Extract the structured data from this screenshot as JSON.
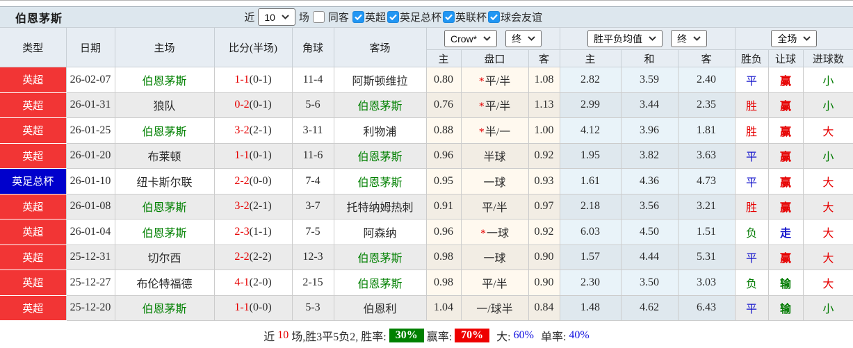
{
  "title": "伯恩茅斯",
  "controls": {
    "near_label": "近",
    "match_count": "10",
    "matches_label": "场",
    "same_opponent_label": "同客",
    "same_opponent_checked": false,
    "competitions": [
      {
        "label": "英超",
        "checked": true
      },
      {
        "label": "英足总杯",
        "checked": true
      },
      {
        "label": "英联杯",
        "checked": true
      },
      {
        "label": "球会友谊",
        "checked": true
      }
    ]
  },
  "selectors": {
    "odds_company": "Crow*",
    "odds_stage": "终",
    "mean_type": "胜平负均值",
    "mean_stage": "终",
    "scope": "全场"
  },
  "columns": {
    "type": "类型",
    "date": "日期",
    "home": "主场",
    "score": "比分(半场)",
    "corners": "角球",
    "away": "客场",
    "odds_home": "主",
    "handicap": "盘口",
    "odds_away": "客",
    "mean_home": "主",
    "mean_draw": "和",
    "mean_away": "客",
    "result": "胜负",
    "handicap_result": "让球",
    "goals": "进球数"
  },
  "rows": [
    {
      "type": "英超",
      "badge": "league",
      "date": "26-02-07",
      "home": "伯恩茅斯",
      "home_self": true,
      "score": "1-1",
      "half": "(0-1)",
      "corners": "11-4",
      "away": "阿斯顿维拉",
      "away_self": false,
      "odds_home": "0.80",
      "star": true,
      "handicap": "平/半",
      "odds_away": "1.08",
      "mean_home": "2.82",
      "mean_draw": "3.59",
      "mean_away": "2.40",
      "result": "平",
      "result_color": "blue",
      "handicap_result": "赢",
      "handicap_result_color": "red",
      "goals": "小",
      "goals_color": "green"
    },
    {
      "type": "英超",
      "badge": "league",
      "date": "26-01-31",
      "home": "狼队",
      "home_self": false,
      "score": "0-2",
      "half": "(0-1)",
      "corners": "5-6",
      "away": "伯恩茅斯",
      "away_self": true,
      "odds_home": "0.76",
      "star": true,
      "handicap": "平/半",
      "odds_away": "1.13",
      "mean_home": "2.99",
      "mean_draw": "3.44",
      "mean_away": "2.35",
      "result": "胜",
      "result_color": "red",
      "handicap_result": "赢",
      "handicap_result_color": "red",
      "goals": "小",
      "goals_color": "green"
    },
    {
      "type": "英超",
      "badge": "league",
      "date": "26-01-25",
      "home": "伯恩茅斯",
      "home_self": true,
      "score": "3-2",
      "half": "(2-1)",
      "corners": "3-11",
      "away": "利物浦",
      "away_self": false,
      "odds_home": "0.88",
      "star": true,
      "handicap": "半/一",
      "odds_away": "1.00",
      "mean_home": "4.12",
      "mean_draw": "3.96",
      "mean_away": "1.81",
      "result": "胜",
      "result_color": "red",
      "handicap_result": "赢",
      "handicap_result_color": "red",
      "goals": "大",
      "goals_color": "red"
    },
    {
      "type": "英超",
      "badge": "league",
      "date": "26-01-20",
      "home": "布莱顿",
      "home_self": false,
      "score": "1-1",
      "half": "(0-1)",
      "corners": "11-6",
      "away": "伯恩茅斯",
      "away_self": true,
      "odds_home": "0.96",
      "star": false,
      "handicap": "半球",
      "odds_away": "0.92",
      "mean_home": "1.95",
      "mean_draw": "3.82",
      "mean_away": "3.63",
      "result": "平",
      "result_color": "blue",
      "handicap_result": "赢",
      "handicap_result_color": "red",
      "goals": "小",
      "goals_color": "green"
    },
    {
      "type": "英足总杯",
      "badge": "cup",
      "date": "26-01-10",
      "home": "纽卡斯尔联",
      "home_self": false,
      "score": "2-2",
      "half": "(0-0)",
      "corners": "7-4",
      "away": "伯恩茅斯",
      "away_self": true,
      "odds_home": "0.95",
      "star": false,
      "handicap": "一球",
      "odds_away": "0.93",
      "mean_home": "1.61",
      "mean_draw": "4.36",
      "mean_away": "4.73",
      "result": "平",
      "result_color": "blue",
      "handicap_result": "赢",
      "handicap_result_color": "red",
      "goals": "大",
      "goals_color": "red"
    },
    {
      "type": "英超",
      "badge": "league",
      "date": "26-01-08",
      "home": "伯恩茅斯",
      "home_self": true,
      "score": "3-2",
      "half": "(2-1)",
      "corners": "3-7",
      "away": "托特纳姆热刺",
      "away_self": false,
      "odds_home": "0.91",
      "star": false,
      "handicap": "平/半",
      "odds_away": "0.97",
      "mean_home": "2.18",
      "mean_draw": "3.56",
      "mean_away": "3.21",
      "result": "胜",
      "result_color": "red",
      "handicap_result": "赢",
      "handicap_result_color": "red",
      "goals": "大",
      "goals_color": "red"
    },
    {
      "type": "英超",
      "badge": "league",
      "date": "26-01-04",
      "home": "伯恩茅斯",
      "home_self": true,
      "score": "2-3",
      "half": "(1-1)",
      "corners": "7-5",
      "away": "阿森纳",
      "away_self": false,
      "odds_home": "0.96",
      "star": true,
      "handicap": "一球",
      "odds_away": "0.92",
      "mean_home": "6.03",
      "mean_draw": "4.50",
      "mean_away": "1.51",
      "result": "负",
      "result_color": "green",
      "handicap_result": "走",
      "handicap_result_color": "blue",
      "goals": "大",
      "goals_color": "red"
    },
    {
      "type": "英超",
      "badge": "league",
      "date": "25-12-31",
      "home": "切尔西",
      "home_self": false,
      "score": "2-2",
      "half": "(2-2)",
      "corners": "12-3",
      "away": "伯恩茅斯",
      "away_self": true,
      "odds_home": "0.98",
      "star": false,
      "handicap": "一球",
      "odds_away": "0.90",
      "mean_home": "1.57",
      "mean_draw": "4.44",
      "mean_away": "5.31",
      "result": "平",
      "result_color": "blue",
      "handicap_result": "赢",
      "handicap_result_color": "red",
      "goals": "大",
      "goals_color": "red"
    },
    {
      "type": "英超",
      "badge": "league",
      "date": "25-12-27",
      "home": "布伦特福德",
      "home_self": false,
      "score": "4-1",
      "half": "(2-0)",
      "corners": "2-15",
      "away": "伯恩茅斯",
      "away_self": true,
      "odds_home": "0.98",
      "star": false,
      "handicap": "平/半",
      "odds_away": "0.90",
      "mean_home": "2.30",
      "mean_draw": "3.50",
      "mean_away": "3.03",
      "result": "负",
      "result_color": "green",
      "handicap_result": "输",
      "handicap_result_color": "green",
      "goals": "大",
      "goals_color": "red"
    },
    {
      "type": "英超",
      "badge": "league",
      "date": "25-12-20",
      "home": "伯恩茅斯",
      "home_self": true,
      "score": "1-1",
      "half": "(0-0)",
      "corners": "5-3",
      "away": "伯恩利",
      "away_self": false,
      "odds_home": "1.04",
      "star": false,
      "handicap": "一/球半",
      "odds_away": "0.84",
      "mean_home": "1.48",
      "mean_draw": "4.62",
      "mean_away": "6.43",
      "result": "平",
      "result_color": "blue",
      "handicap_result": "输",
      "handicap_result_color": "green",
      "goals": "小",
      "goals_color": "green"
    }
  ],
  "summary": {
    "near_label": "近",
    "count": "10",
    "segment1": "场,胜3平5负2, 胜率:",
    "win_rate": "30%",
    "segment2": "赢率:",
    "win_rate2": "70%",
    "big_label": "大:",
    "big_rate": "60%",
    "single_label": "单率:",
    "single_rate": "40%"
  },
  "colors": {
    "red": "#e60000",
    "blue": "#1414cc",
    "green": "#007a00",
    "league_badge_bg": "#f23535",
    "cup_badge_bg": "#0000cc",
    "self_team": "#008000",
    "rate_green_bg": "#008000",
    "rate_red_bg": "#ee0000",
    "pct_blue": "#1414e0"
  }
}
